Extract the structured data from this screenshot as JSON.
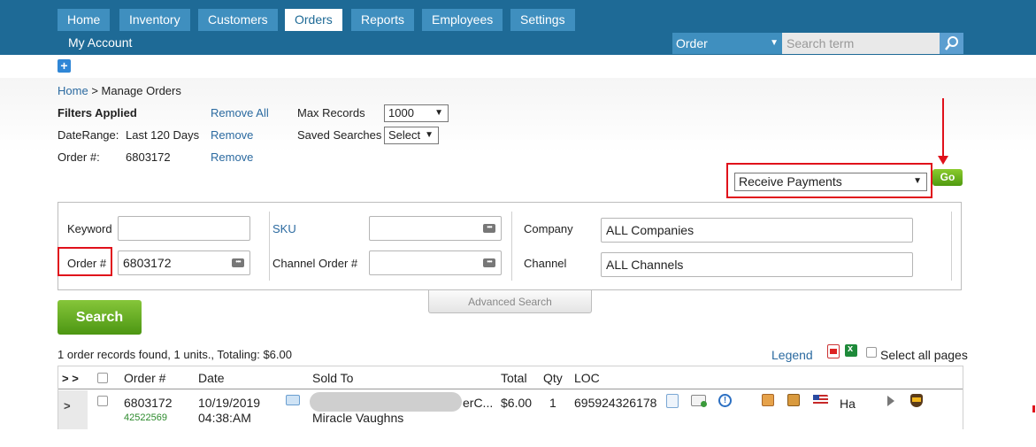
{
  "nav": {
    "tabs": [
      {
        "label": "Home"
      },
      {
        "label": "Inventory"
      },
      {
        "label": "Customers"
      },
      {
        "label": "Orders"
      },
      {
        "label": "Reports"
      },
      {
        "label": "Employees"
      },
      {
        "label": "Settings"
      }
    ],
    "my_account": "My Account",
    "search_scope": "Order",
    "search_placeholder": "Search term"
  },
  "breadcrumb": {
    "home": "Home",
    "separator": ">",
    "current": "Manage Orders"
  },
  "filters": {
    "title": "Filters Applied",
    "remove_all": "Remove All",
    "date_label": "DateRange:",
    "date_value": "Last 120 Days",
    "remove": "Remove",
    "order_label": "Order #:",
    "order_value": "6803172",
    "max_records_label": "Max Records",
    "max_records_value": "1000",
    "saved_searches_label": "Saved Searches",
    "saved_searches_value": "Select"
  },
  "action": {
    "value": "Receive Payments",
    "go": "Go"
  },
  "search_panel": {
    "keyword_label": "Keyword",
    "keyword_value": "",
    "order_label": "Order #",
    "order_value": "6803172",
    "sku_label": "SKU",
    "channel_order_label": "Channel Order #",
    "company_label": "Company",
    "company_value": "ALL Companies",
    "channel_label": "Channel",
    "channel_value": "ALL Channels",
    "advanced": "Advanced Search",
    "search_button": "Search"
  },
  "results": {
    "summary": "1 order records found, 1 units., Totaling: $6.00",
    "legend": "Legend",
    "select_all_pages": "Select all pages"
  },
  "table": {
    "expand": "> >",
    "headers": [
      "Order #",
      "Date",
      "Sold To",
      "Total",
      "Qty",
      "LOC"
    ],
    "rows": [
      {
        "order": "6803172",
        "sub_order": "42522569",
        "date": "10/19/2019",
        "time": "04:38:AM",
        "sold_to_suffix": "erC...",
        "sold_to_name": "Miracle Vaughns",
        "total": "$6.00",
        "qty": "1",
        "loc": "695924326178",
        "ship_code": "Ha"
      }
    ]
  },
  "colors": {
    "nav_bg": "#1e6a96",
    "tab_bg": "#3f8fbf",
    "highlight": "#e0111b",
    "green": "#5fa91f"
  }
}
